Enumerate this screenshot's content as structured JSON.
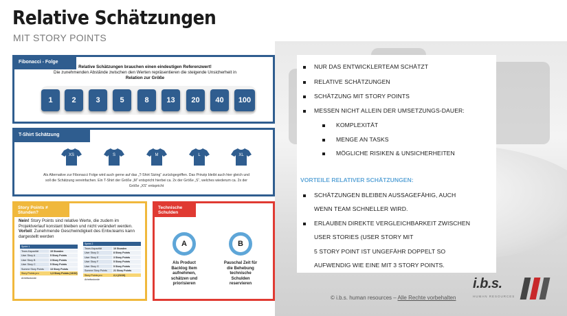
{
  "header": {
    "title": "Relative Schätzungen",
    "subtitle": "MIT STORY POINTS"
  },
  "fibonacci": {
    "header": "Fibonacci - Folge",
    "line1": "Relative Schätzungen brauchen einen eindeutigen Referenzwert!",
    "line2": "Die zunehmenden Abstände zwischen den Werten repräsentieren die steigende Unsicherheit in",
    "line3": "Relation zur Größe",
    "cards": [
      "1",
      "2",
      "3",
      "5",
      "8",
      "13",
      "20",
      "40",
      "100"
    ]
  },
  "tshirt": {
    "header": "T-Shirt Schätzung",
    "sizes": [
      "XS",
      "S",
      "M",
      "L",
      "XL"
    ],
    "text1": "Als Alternative zur Fibonacci Folge wird auch gerne auf das „T-Shirt Sizing“ zurückgegriffen. Das Prinzip bleibt auch hier gleich und",
    "text2": "soll die Schätzung vereinfachen. Ein T-Shirt der Größe „M“ entspricht hierbei ca. 2x der Größe „S“, welches wiederum ca. 2x der",
    "text3": "Größe „XS“ entspricht"
  },
  "story_points": {
    "header_line1": "Story Points ≠",
    "header_line2": "Stunden?",
    "bold1": "Nein!",
    "text1": " Story Points sind relative Werte, die zudem im Projektverlauf konstant bleiben und nicht verändert werden.",
    "bold2": "Vorteil",
    "text2": ": Zunehmende Geschwindigkeit des Entw.teams kann dargestellt werden",
    "sprint1": {
      "title": "Sprint 1",
      "rows": [
        [
          "Team-Kapazität",
          "15 Stunden"
        ],
        [
          "User Story A",
          "5 Story Points"
        ],
        [
          "User Story B",
          "3 Story Points"
        ],
        [
          "User Story C",
          "5 Story Points"
        ],
        [
          "Summe Story Points",
          "13 Story Points"
        ],
        [
          "Story Points pro Arbeitsstunde",
          "1,3 Story Points (13/10)"
        ]
      ]
    },
    "sprint2": {
      "title": "Sprint 2",
      "rows": [
        [
          "Team-Kapazität",
          "10 Stunden"
        ],
        [
          "User Story D",
          "8 Story Points"
        ],
        [
          "User Story E",
          "3 Story Points"
        ],
        [
          "User Story F",
          "5 Story Points"
        ],
        [
          "User Story G",
          "5 Story Points"
        ],
        [
          "Summe Story Points",
          "21 Story Points"
        ],
        [
          "Story Points pro Arbeitsstunde",
          "2,1 (21/10)"
        ]
      ]
    }
  },
  "tech_debt": {
    "header_line1": "Technische",
    "header_line2": "Schulden",
    "a_label": "A",
    "b_label": "B",
    "a_caption": [
      "Als Product",
      "Backlog Item",
      "aufnehmen,",
      "schätzen und",
      "priorisieren"
    ],
    "b_caption": [
      "Pauschal Zeit für",
      "die Behebung",
      "technische",
      "Schulden",
      "reservieren"
    ]
  },
  "bullets": {
    "main": [
      "NUR DAS ENTWICKLERTEAM SCHÄTZT",
      "RELATIVE SCHÄTZUNGEN",
      "SCHÄTZUNG MIT STORY POINTS",
      "MESSEN NICHT ALLEIN DER UMSETZUNGS-DAUER:"
    ],
    "sub": [
      "KOMPLEXITÄT",
      "MENGE AN TASKS",
      "MÖGLICHE RISIKEN & UNSICHERHEITEN"
    ],
    "advantages_title": "VORTEILE  RELATIVER SCHÄTZUNGEN:",
    "adv1_line1": "SCHÄTZUNGEN BLEIBEN AUSSAGEFÄHIG, AUCH",
    "adv1_line2": "WENN TEAM SCHNELLER WIRD.",
    "adv2_line1": "ERLAUBEN DIREKTE VERGLEICHBARKEIT ZWISCHEN",
    "adv2_line2": "USER STORIES (USER STORY MIT",
    "adv2_line3": "5 STORY POINT IST UNGEFÄHR DOPPELT SO",
    "adv2_line4": "AUFWENDIG WIE EINE MIT 3 STORY POINTS."
  },
  "footer": {
    "prefix": "© i.b.s. human resources – ",
    "rights": "Alle Rechte vorbehalten"
  },
  "logo": {
    "text": "i.b.s.",
    "sub": "HUMAN RESOURCES"
  },
  "colors": {
    "primary_blue": "#2f5d8f",
    "accent_blue": "#5ea6d8",
    "yellow": "#f0b83c",
    "red": "#e03a32"
  }
}
